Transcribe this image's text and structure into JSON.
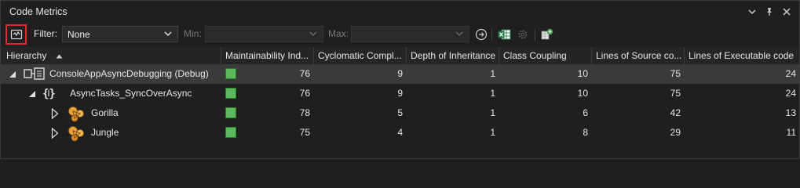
{
  "window": {
    "title": "Code Metrics",
    "icons": [
      "chevron-down-icon",
      "pin-icon",
      "close-icon"
    ]
  },
  "toolbar": {
    "filter_label": "Filter:",
    "filter_value": "None",
    "min_label": "Min:",
    "min_value": "",
    "max_label": "Max:",
    "max_value": "",
    "icons": [
      "calculate-metrics-icon",
      "apply-filter-icon",
      "excel-export-icon",
      "settings-icon",
      "add-column-icon"
    ]
  },
  "columns": [
    "Hierarchy",
    "Maintainability Ind...",
    "Cyclomatic Compl...",
    "Depth of Inheritance",
    "Class Coupling",
    "Lines of Source co...",
    "Lines of Executable code"
  ],
  "sort": {
    "column": "Hierarchy",
    "direction": "ascending"
  },
  "colors": {
    "accent_red": "#e8262f",
    "mi_green": "#5cb85c",
    "selected_row": "#3a3a3a"
  },
  "rows": [
    {
      "name": "ConsoleAppAsyncDebugging (Debug)",
      "icon": "assembly-icon",
      "expanded": true,
      "maintainability": "76",
      "cyclomatic": "9",
      "depth": "1",
      "coupling": "10",
      "source_lines": "75",
      "exec_lines": "24"
    },
    {
      "name": "AsyncTasks_SyncOverAsync",
      "icon": "namespace-icon",
      "expanded": true,
      "maintainability": "76",
      "cyclomatic": "9",
      "depth": "1",
      "coupling": "10",
      "source_lines": "75",
      "exec_lines": "24"
    },
    {
      "name": "Gorilla",
      "icon": "class-icon",
      "expanded": false,
      "maintainability": "78",
      "cyclomatic": "5",
      "depth": "1",
      "coupling": "6",
      "source_lines": "42",
      "exec_lines": "13"
    },
    {
      "name": "Jungle",
      "icon": "class-icon",
      "expanded": false,
      "maintainability": "75",
      "cyclomatic": "4",
      "depth": "1",
      "coupling": "8",
      "source_lines": "29",
      "exec_lines": "11"
    }
  ]
}
